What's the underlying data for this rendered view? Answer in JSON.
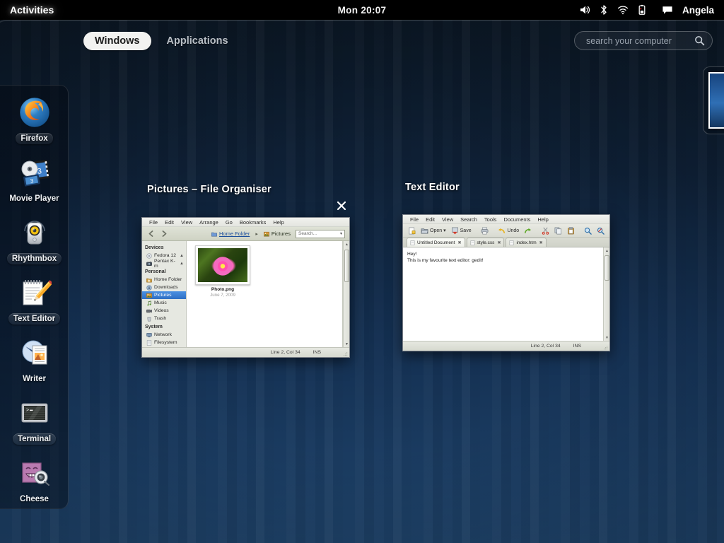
{
  "top_panel": {
    "activities_label": "Activities",
    "clock": "Mon 20:07",
    "user_name": "Angela",
    "tray_icons": [
      "volume-icon",
      "bluetooth-icon",
      "wifi-icon",
      "battery-icon",
      "chat-icon"
    ]
  },
  "overview": {
    "view_switcher": [
      {
        "label": "Windows",
        "active": true
      },
      {
        "label": "Applications",
        "active": false
      }
    ],
    "search": {
      "placeholder": "search your computer",
      "value": "",
      "icon": "search-icon"
    }
  },
  "dash": {
    "items": [
      {
        "label": "Firefox",
        "icon": "firefox-icon",
        "running": true
      },
      {
        "label": "Movie Player",
        "icon": "movie-player-icon",
        "running": false
      },
      {
        "label": "Rhythmbox",
        "icon": "rhythmbox-icon",
        "running": true
      },
      {
        "label": "Text Editor",
        "icon": "text-editor-icon",
        "running": true
      },
      {
        "label": "Writer",
        "icon": "writer-icon",
        "running": false
      },
      {
        "label": "Terminal",
        "icon": "terminal-icon",
        "running": true
      },
      {
        "label": "Cheese",
        "icon": "cheese-icon",
        "running": false
      }
    ]
  },
  "windows": {
    "file_organiser": {
      "title": "Pictures – File Organiser",
      "close_icon": "close-icon",
      "menus": [
        "File",
        "Edit",
        "View",
        "Arrange",
        "Go",
        "Bookmarks",
        "Help"
      ],
      "nav": {
        "back_icon": "back-arrow-icon",
        "forward_icon": "forward-arrow-icon"
      },
      "breadcrumbs": [
        {
          "label": "Home Folder",
          "icon": "folder-icon",
          "is_link": true
        },
        {
          "label": "Pictures",
          "icon": "pictures-folder-icon",
          "is_link": false
        }
      ],
      "breadcrumb_separator": "▸",
      "search": {
        "placeholder": "Search...",
        "value": "",
        "dropdown_icon": "chevron-down-icon"
      },
      "sidebar": [
        {
          "type": "header",
          "label": "Devices"
        },
        {
          "type": "item",
          "label": "Fedora 12",
          "icon": "disc-icon",
          "selected": false,
          "eject": true
        },
        {
          "type": "item",
          "label": "Pentax K-m",
          "icon": "camera-icon",
          "selected": false,
          "eject": true
        },
        {
          "type": "header",
          "label": "Personal"
        },
        {
          "type": "item",
          "label": "Home Folder",
          "icon": "home-icon",
          "selected": false,
          "eject": false
        },
        {
          "type": "item",
          "label": "Downloads",
          "icon": "downloads-icon",
          "selected": false,
          "eject": false
        },
        {
          "type": "item",
          "label": "Pictures",
          "icon": "pictures-icon",
          "selected": true,
          "eject": false
        },
        {
          "type": "item",
          "label": "Music",
          "icon": "music-icon",
          "selected": false,
          "eject": false
        },
        {
          "type": "item",
          "label": "Videos",
          "icon": "video-icon",
          "selected": false,
          "eject": false
        },
        {
          "type": "item",
          "label": "Trash",
          "icon": "trash-icon",
          "selected": false,
          "eject": false
        },
        {
          "type": "header",
          "label": "System"
        },
        {
          "type": "item",
          "label": "Network",
          "icon": "network-icon",
          "selected": false,
          "eject": false
        },
        {
          "type": "item",
          "label": "Filesystem",
          "icon": "filesystem-icon",
          "selected": false,
          "eject": false
        }
      ],
      "files": [
        {
          "name": "Photo.png",
          "date": "June 7, 2009",
          "icon": "image-thumbnail"
        }
      ],
      "status": {
        "position": "Line 2, Col 34",
        "mode": "INS"
      }
    },
    "text_editor": {
      "title": "Text Editor",
      "menus": [
        "File",
        "Edit",
        "View",
        "Search",
        "Tools",
        "Documents",
        "Help"
      ],
      "toolbar": [
        {
          "label": "",
          "icon": "new-document-icon"
        },
        {
          "label": "Open",
          "icon": "open-folder-icon",
          "has_arrow": true
        },
        {
          "label": "Save",
          "icon": "save-icon"
        },
        {
          "label": "",
          "icon": "print-icon"
        },
        {
          "label": "Undo",
          "icon": "undo-icon"
        },
        {
          "label": "",
          "icon": "redo-icon"
        },
        {
          "label": "",
          "icon": "cut-icon"
        },
        {
          "label": "",
          "icon": "copy-icon"
        },
        {
          "label": "",
          "icon": "paste-icon"
        },
        {
          "label": "",
          "icon": "find-icon"
        },
        {
          "label": "",
          "icon": "replace-icon"
        }
      ],
      "tabs": [
        {
          "label": "Untitled Document",
          "active": true,
          "close_icon": "close-icon"
        },
        {
          "label": "style.css",
          "active": false,
          "close_icon": "close-icon"
        },
        {
          "label": "index.htm",
          "active": false,
          "close_icon": "close-icon"
        }
      ],
      "document_lines": [
        "Hey!",
        "This is my favourite text editor: gedit!"
      ],
      "status": {
        "position": "Line 2, Col 34",
        "mode": "INS"
      }
    }
  },
  "colors": {
    "panel_bg": "#000000",
    "desktop_top": "#0b1724",
    "desktop_bottom": "#1e4269",
    "selection_blue": "#2f6fc4",
    "active_pill_bg": "#f2f2f0",
    "link_blue": "#1b4e9b"
  }
}
